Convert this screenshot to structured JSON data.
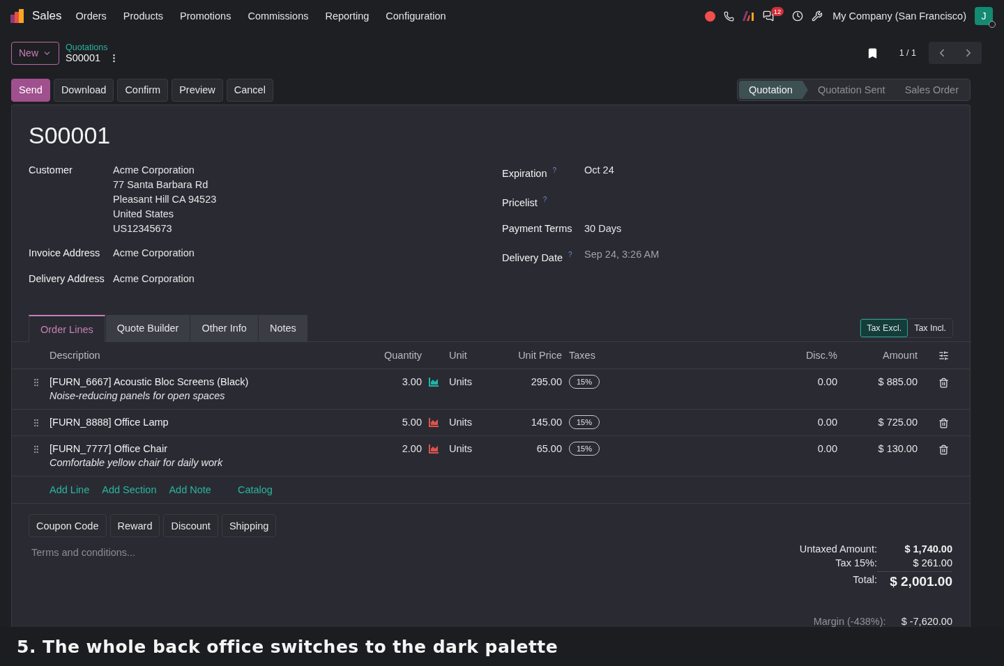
{
  "navbar": {
    "app": "Sales",
    "menus": [
      "Orders",
      "Products",
      "Promotions",
      "Commissions",
      "Reporting",
      "Configuration"
    ],
    "messages_count": "12",
    "company": "My Company (San Francisco)",
    "avatar_initial": "J"
  },
  "control_panel": {
    "new_button": "New",
    "breadcrumb": "Quotations",
    "record": "S00001",
    "pager": "1 / 1"
  },
  "actions": [
    {
      "label": "Send",
      "primary": true
    },
    {
      "label": "Download",
      "primary": false
    },
    {
      "label": "Confirm",
      "primary": false
    },
    {
      "label": "Preview",
      "primary": false
    },
    {
      "label": "Cancel",
      "primary": false
    }
  ],
  "status_bar": [
    {
      "label": "Quotation",
      "selected": true
    },
    {
      "label": "Quotation Sent",
      "selected": false
    },
    {
      "label": "Sales Order",
      "selected": false
    }
  ],
  "form": {
    "title": "S00001",
    "left_fields": [
      {
        "label": "Customer",
        "lines": [
          "Acme Corporation",
          "77 Santa Barbara Rd",
          "Pleasant Hill CA 94523",
          "United States",
          "US12345673"
        ]
      },
      {
        "label": "Invoice Address",
        "lines": [
          "Acme Corporation"
        ]
      },
      {
        "label": "Delivery Address",
        "lines": [
          "Acme Corporation"
        ]
      }
    ],
    "right_fields": [
      {
        "label": "Expiration",
        "help": "?",
        "value": "Oct 24"
      },
      {
        "label": "Pricelist",
        "help": "?"
      },
      {
        "label": "Payment Terms",
        "value": "30 Days"
      },
      {
        "label": "Delivery Date",
        "help": "?",
        "placeholder": "Sep 24, 3:26 AM"
      }
    ]
  },
  "tabs": [
    {
      "label": "Order Lines",
      "selected": true
    },
    {
      "label": "Quote Builder",
      "selected": false
    },
    {
      "label": "Other Info",
      "selected": false
    },
    {
      "label": "Notes",
      "selected": false
    }
  ],
  "tax_toggle": [
    {
      "label": "Tax Excl.",
      "selected": true
    },
    {
      "label": "Tax Incl.",
      "selected": false
    }
  ],
  "table": {
    "columns": [
      "Description",
      "Quantity",
      "Unit",
      "Unit Price",
      "Taxes",
      "Disc.%",
      "Amount"
    ],
    "rows": [
      {
        "product": "[FURN_6667] Acoustic Bloc Screens (Black)",
        "note": "Noise-reducing panels for open spaces",
        "quantity": "3.00",
        "color": "#1fb5a8",
        "unit": "Units",
        "unit_price": "295.00",
        "tax": "15%",
        "discount": "0.00",
        "amount": "$ 885.00"
      },
      {
        "product": "[FURN_8888] Office Lamp",
        "quantity": "5.00",
        "color": "#e0524f",
        "unit": "Units",
        "unit_price": "145.00",
        "tax": "15%",
        "discount": "0.00",
        "amount": "$ 725.00"
      },
      {
        "product": "[FURN_7777] Office Chair",
        "note": "Comfortable yellow chair for daily work",
        "quantity": "2.00",
        "color": "#e0524f",
        "unit": "Units",
        "unit_price": "65.00",
        "tax": "15%",
        "discount": "0.00",
        "amount": "$ 130.00"
      }
    ]
  },
  "add_links": [
    "Add Line",
    "Add Section",
    "Add Note",
    "Catalog"
  ],
  "program_buttons": [
    "Coupon Code",
    "Reward",
    "Discount",
    "Shipping"
  ],
  "terms": {
    "placeholder": "Terms and conditions..."
  },
  "totals": [
    {
      "label": "Untaxed Amount:",
      "value": "$ 1,740.00",
      "kind": "subtotal"
    },
    {
      "label": "Tax 15%:",
      "value": "$ 261.00",
      "kind": "tax"
    },
    {
      "label": "Total:",
      "value": "$ 2,001.00",
      "kind": "total"
    }
  ],
  "margin": {
    "label": "Margin (-438%):",
    "value": "$ -7,620.00"
  },
  "caption": "5. The whole back office switches to the dark palette"
}
